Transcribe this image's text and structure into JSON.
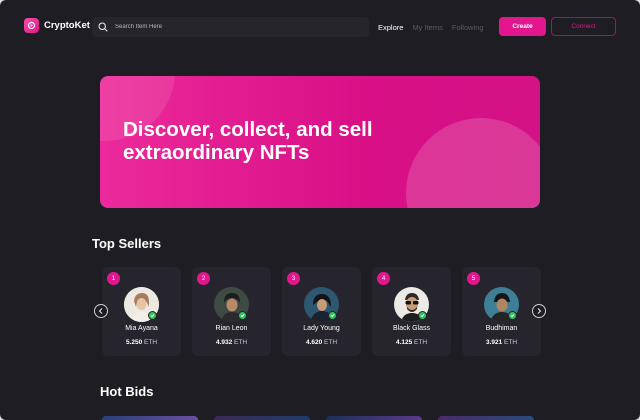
{
  "brand": {
    "name": "CryptoKet",
    "accent": "#e3178d"
  },
  "search": {
    "placeholder": "Search Item Here",
    "icon": "search-icon"
  },
  "nav": {
    "links": [
      {
        "label": "Explore",
        "active": true
      },
      {
        "label": "My Items",
        "active": false
      },
      {
        "label": "Following",
        "active": false
      }
    ],
    "create_label": "Create",
    "connect_label": "Connect"
  },
  "hero": {
    "line1": "Discover, collect, and sell",
    "line2": "extraordinary NFTs"
  },
  "top_sellers": {
    "title": "Top Sellers",
    "sellers": [
      {
        "rank": "1",
        "name": "Mia Ayana",
        "amount": "5.250",
        "unit": "ETH"
      },
      {
        "rank": "2",
        "name": "Rian Leon",
        "amount": "4.932",
        "unit": "ETH"
      },
      {
        "rank": "3",
        "name": "Lady Young",
        "amount": "4.620",
        "unit": "ETH"
      },
      {
        "rank": "4",
        "name": "Black Glass",
        "amount": "4.125",
        "unit": "ETH"
      },
      {
        "rank": "5",
        "name": "Budhiman",
        "amount": "3.921",
        "unit": "ETH"
      }
    ]
  },
  "hot_bids": {
    "title": "Hot Bids"
  }
}
